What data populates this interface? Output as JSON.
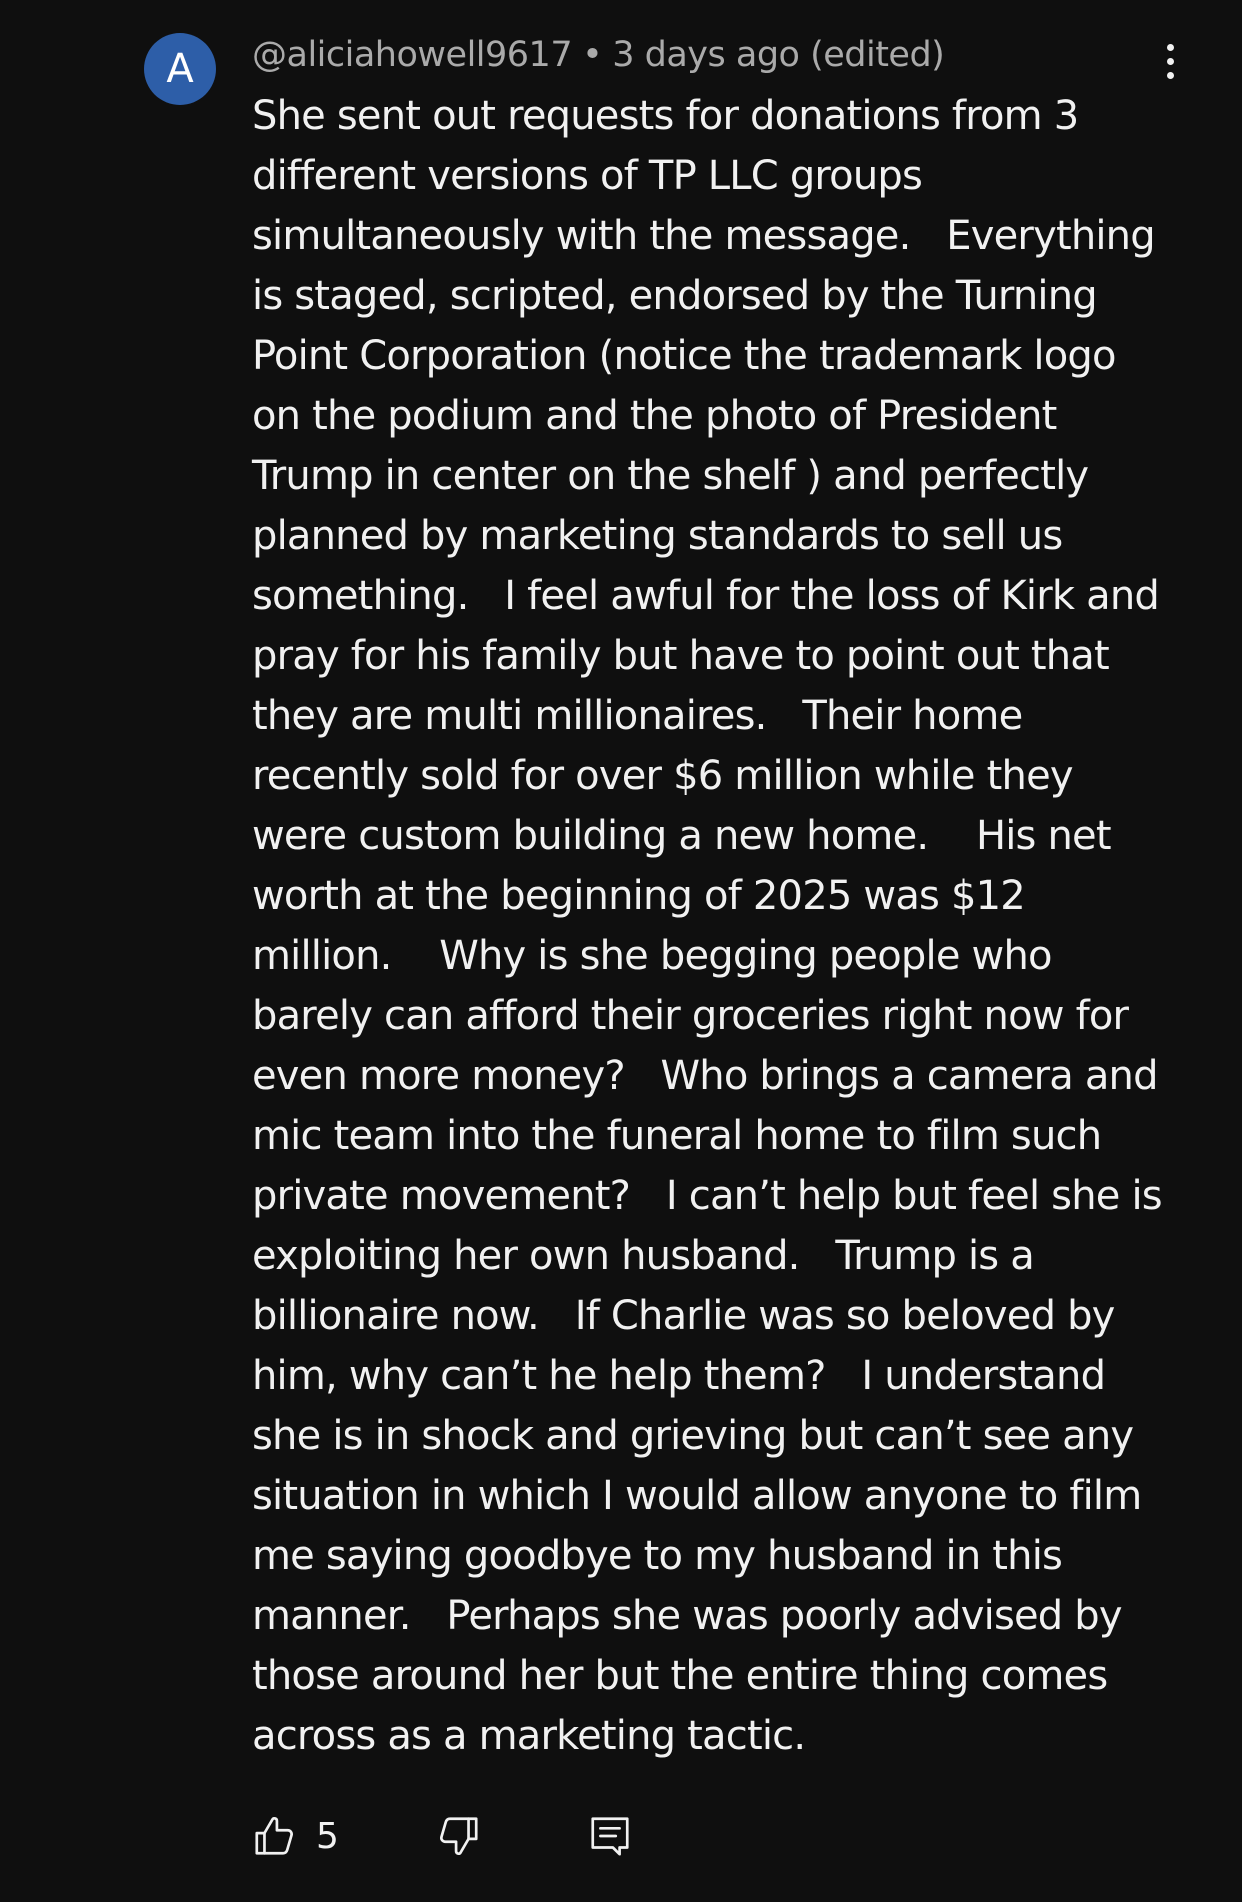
{
  "comment": {
    "avatar_letter": "A",
    "author": "@aliciahowell9617",
    "separator": "•",
    "time": "3 days ago (edited)",
    "body_lines": [
      "She sent out requests for donations from 3",
      "different versions of TP LLC groups",
      "simultaneously with the message.   Everything",
      "is staged, scripted, endorsed by the Turning",
      "Point Corporation (notice the trademark logo",
      "on the podium and the photo of President",
      "Trump in center on the shelf ) and perfectly",
      "planned by marketing standards to sell us",
      "something.   I feel awful for the loss of Kirk and",
      "pray for his family but have to point out that",
      "they are multi millionaires.   Their home",
      "recently sold for over $6 million while they",
      "were custom building a new home.    His net",
      "worth at the beginning of 2025 was $12",
      "million.    Why is she begging people who",
      "barely can afford their groceries right now for",
      "even more money?   Who brings a camera and",
      "mic team into the funeral home to film such",
      "private movement?   I can’t help but feel she is",
      "exploiting her own husband.   Trump is a",
      "billionaire now.   If Charlie was so beloved by",
      "him, why can’t he help them?   I understand",
      "she is in shock and grieving but can’t see any",
      "situation in which I would allow anyone to film",
      "me saying goodbye to my husband in this",
      "manner.   Perhaps she was poorly advised by",
      "those around her but the entire thing comes",
      "across as a marketing tactic."
    ],
    "like_count": "5"
  },
  "icons": {
    "more": "more-vert-icon",
    "like": "thumbs-up-icon",
    "dislike": "thumbs-down-icon",
    "reply": "comment-reply-icon"
  },
  "colors": {
    "background": "#0f0f0f",
    "text": "#f1f1f1",
    "meta": "#aaaaaa",
    "avatar": "#2d5ea8"
  }
}
